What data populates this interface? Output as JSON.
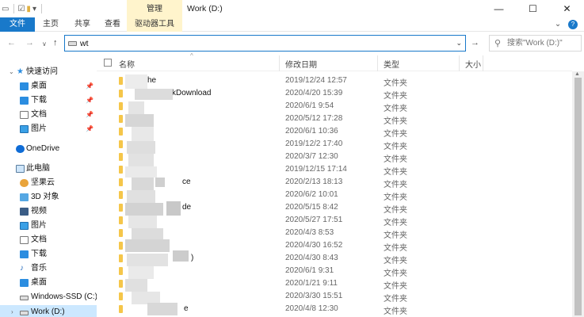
{
  "window": {
    "title": "Work (D:)",
    "manage_tab": "管理",
    "controls": {
      "minimize": "—",
      "maximize": "☐",
      "close": "✕"
    }
  },
  "ribbon": {
    "tabs": [
      {
        "label": "文件"
      },
      {
        "label": "主页"
      },
      {
        "label": "共享"
      },
      {
        "label": "查看"
      },
      {
        "label": "驱动器工具"
      }
    ],
    "expand_icon": "chevron-down-icon",
    "help_icon": "help-icon"
  },
  "address": {
    "value": "wt",
    "search_placeholder": "搜索\"Work (D:)\""
  },
  "nav": {
    "items": [
      {
        "label": "快速访问",
        "icon": "star-icon"
      },
      {
        "label": "桌面",
        "icon": "desktop-icon"
      },
      {
        "label": "下载",
        "icon": "download-icon"
      },
      {
        "label": "文档",
        "icon": "document-icon"
      },
      {
        "label": "图片",
        "icon": "picture-icon"
      },
      {
        "label": "OneDrive",
        "icon": "onedrive-icon"
      },
      {
        "label": "此电脑",
        "icon": "pc-icon"
      },
      {
        "label": "坚果云",
        "icon": "nutstore-icon"
      },
      {
        "label": "3D 对象",
        "icon": "3d-objects-icon"
      },
      {
        "label": "视频",
        "icon": "video-icon"
      },
      {
        "label": "图片",
        "icon": "picture-icon"
      },
      {
        "label": "文档",
        "icon": "document-icon"
      },
      {
        "label": "下载",
        "icon": "download-icon"
      },
      {
        "label": "音乐",
        "icon": "music-icon"
      },
      {
        "label": "桌面",
        "icon": "desktop-icon"
      },
      {
        "label": "Windows-SSD (C:)",
        "icon": "drive-icon"
      },
      {
        "label": "Work (D:)",
        "icon": "drive-icon"
      }
    ]
  },
  "columns": {
    "name": "名称",
    "modified": "修改日期",
    "type": "类型",
    "size": "大小"
  },
  "files": [
    {
      "name": "he",
      "modified": "2019/12/24 12:57",
      "type": "文件夹"
    },
    {
      "name": "kDownload",
      "modified": "2020/4/20 15:39",
      "type": "文件夹"
    },
    {
      "name": "",
      "modified": "2020/6/1 9:54",
      "type": "文件夹"
    },
    {
      "name": "",
      "modified": "2020/5/12 17:28",
      "type": "文件夹"
    },
    {
      "name": "",
      "modified": "2020/6/1 10:36",
      "type": "文件夹"
    },
    {
      "name": "",
      "modified": "2019/12/2 17:40",
      "type": "文件夹"
    },
    {
      "name": "",
      "modified": "2020/3/7 12:30",
      "type": "文件夹"
    },
    {
      "name": "",
      "modified": "2019/12/15 17:14",
      "type": "文件夹"
    },
    {
      "name": "ce",
      "modified": "2020/2/13 18:13",
      "type": "文件夹"
    },
    {
      "name": "",
      "modified": "2020/6/2 10:01",
      "type": "文件夹"
    },
    {
      "name": "de",
      "modified": "2020/5/15 8:42",
      "type": "文件夹"
    },
    {
      "name": "",
      "modified": "2020/5/27 17:51",
      "type": "文件夹"
    },
    {
      "name": "",
      "modified": "2020/4/3 8:53",
      "type": "文件夹"
    },
    {
      "name": "",
      "modified": "2020/4/30 16:52",
      "type": "文件夹"
    },
    {
      "name": ")",
      "modified": "2020/4/30 8:43",
      "type": "文件夹"
    },
    {
      "name": "",
      "modified": "2020/6/1 9:31",
      "type": "文件夹"
    },
    {
      "name": "",
      "modified": "2020/1/21 9:11",
      "type": "文件夹"
    },
    {
      "name": "",
      "modified": "2020/3/30 15:51",
      "type": "文件夹"
    },
    {
      "name": "e",
      "modified": "2020/4/8 12:30",
      "type": "文件夹"
    }
  ]
}
